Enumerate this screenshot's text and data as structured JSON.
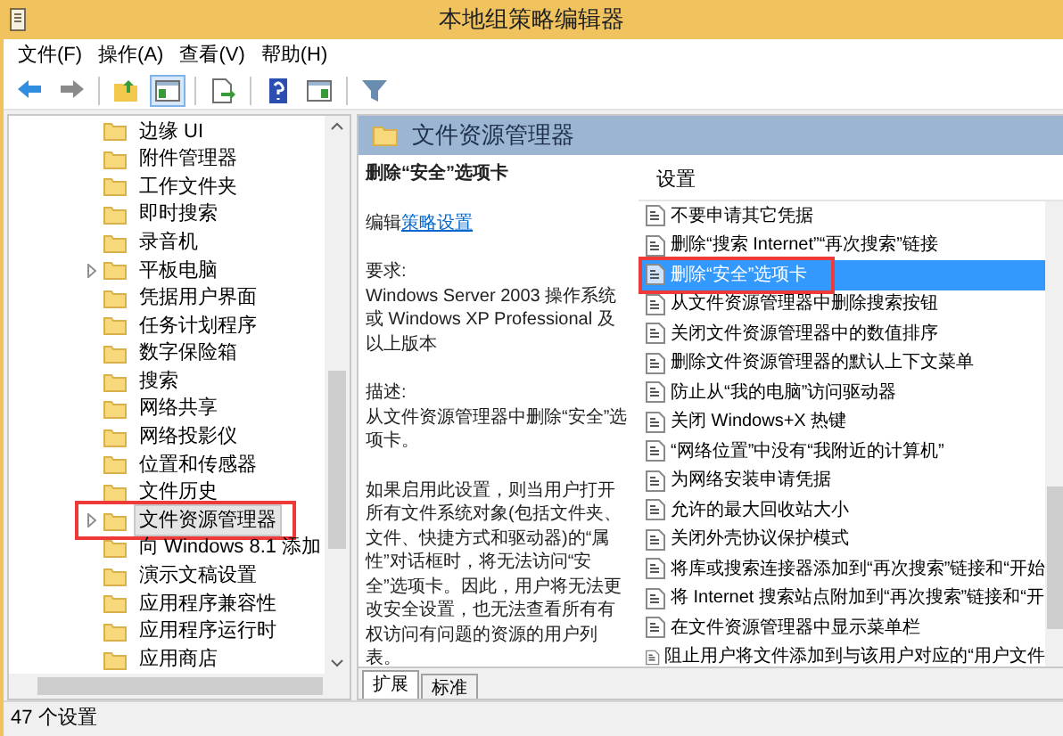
{
  "window": {
    "title": "本地组策略编辑器"
  },
  "menu": [
    "文件(F)",
    "操作(A)",
    "查看(V)",
    "帮助(H)"
  ],
  "toolbar": [
    {
      "kind": "back",
      "pressed": false
    },
    {
      "kind": "forward",
      "pressed": false
    },
    {
      "kind": "sep"
    },
    {
      "kind": "up",
      "pressed": false
    },
    {
      "kind": "tree",
      "pressed": true
    },
    {
      "kind": "sep"
    },
    {
      "kind": "export",
      "pressed": false
    },
    {
      "kind": "sep"
    },
    {
      "kind": "help",
      "pressed": false
    },
    {
      "kind": "pane",
      "pressed": false
    },
    {
      "kind": "sep"
    },
    {
      "kind": "filter",
      "pressed": false
    }
  ],
  "tree": [
    {
      "label": "边缘 UI",
      "expandable": false,
      "selected": false
    },
    {
      "label": "附件管理器",
      "expandable": false,
      "selected": false
    },
    {
      "label": "工作文件夹",
      "expandable": false,
      "selected": false
    },
    {
      "label": "即时搜索",
      "expandable": false,
      "selected": false
    },
    {
      "label": "录音机",
      "expandable": false,
      "selected": false
    },
    {
      "label": "平板电脑",
      "expandable": true,
      "selected": false
    },
    {
      "label": "凭据用户界面",
      "expandable": false,
      "selected": false
    },
    {
      "label": "任务计划程序",
      "expandable": false,
      "selected": false
    },
    {
      "label": "数字保险箱",
      "expandable": false,
      "selected": false
    },
    {
      "label": "搜索",
      "expandable": false,
      "selected": false
    },
    {
      "label": "网络共享",
      "expandable": false,
      "selected": false
    },
    {
      "label": "网络投影仪",
      "expandable": false,
      "selected": false
    },
    {
      "label": "位置和传感器",
      "expandable": false,
      "selected": false
    },
    {
      "label": "文件历史",
      "expandable": false,
      "selected": false
    },
    {
      "label": "文件资源管理器",
      "expandable": true,
      "selected": true
    },
    {
      "label": "向 Windows 8.1 添加",
      "expandable": false,
      "selected": false
    },
    {
      "label": "演示文稿设置",
      "expandable": false,
      "selected": false
    },
    {
      "label": "应用程序兼容性",
      "expandable": false,
      "selected": false
    },
    {
      "label": "应用程序运行时",
      "expandable": false,
      "selected": false
    },
    {
      "label": "应用商店",
      "expandable": false,
      "selected": false
    }
  ],
  "detail": {
    "header": "文件资源管理器",
    "setting_title": "删除“安全”选项卡",
    "edit_prefix": "编辑",
    "edit_link": "策略设置",
    "requirements_label": "要求:",
    "requirements": "Windows Server 2003 操作系统或 Windows XP Professional 及以上版本",
    "description_label": "描述:",
    "description": "从文件资源管理器中删除“安全”选项卡。",
    "details": "如果启用此设置，则当用户打开所有文件系统对象(包括文件夹、文件、快捷方式和驱动器)的“属性”对话框时，将无法访问“安全”选项卡。因此，用户将无法更改安全设置，也无法查看所有有权访问有问题的资源的用户列表。"
  },
  "tabs": [
    {
      "label": "扩展",
      "selected": true
    },
    {
      "label": "标准",
      "selected": false
    }
  ],
  "settings": {
    "column": "设置",
    "rows": [
      {
        "label": "不要申请其它凭据",
        "selected": false
      },
      {
        "label": "删除“搜索 Internet”“再次搜索”链接",
        "selected": false
      },
      {
        "label": "删除“安全”选项卡",
        "selected": true
      },
      {
        "label": "从文件资源管理器中删除搜索按钮",
        "selected": false
      },
      {
        "label": "关闭文件资源管理器中的数值排序",
        "selected": false
      },
      {
        "label": "删除文件资源管理器的默认上下文菜单",
        "selected": false
      },
      {
        "label": "防止从“我的电脑”访问驱动器",
        "selected": false
      },
      {
        "label": "关闭 Windows+X 热键",
        "selected": false
      },
      {
        "label": "“网络位置”中没有“我附近的计算机”",
        "selected": false
      },
      {
        "label": "为网络安装申请凭据",
        "selected": false
      },
      {
        "label": "允许的最大回收站大小",
        "selected": false
      },
      {
        "label": "关闭外壳协议保护模式",
        "selected": false
      },
      {
        "label": "将库或搜索连接器添加到“再次搜索”链接和“开始",
        "selected": false
      },
      {
        "label": "将 Internet 搜索站点附加到“再次搜索”链接和“开",
        "selected": false
      },
      {
        "label": "在文件资源管理器中显示菜单栏",
        "selected": false
      },
      {
        "label": "阻止用户将文件添加到与该用户对应的“用户文件",
        "selected": false
      }
    ]
  },
  "status_bar": "47 个设置"
}
